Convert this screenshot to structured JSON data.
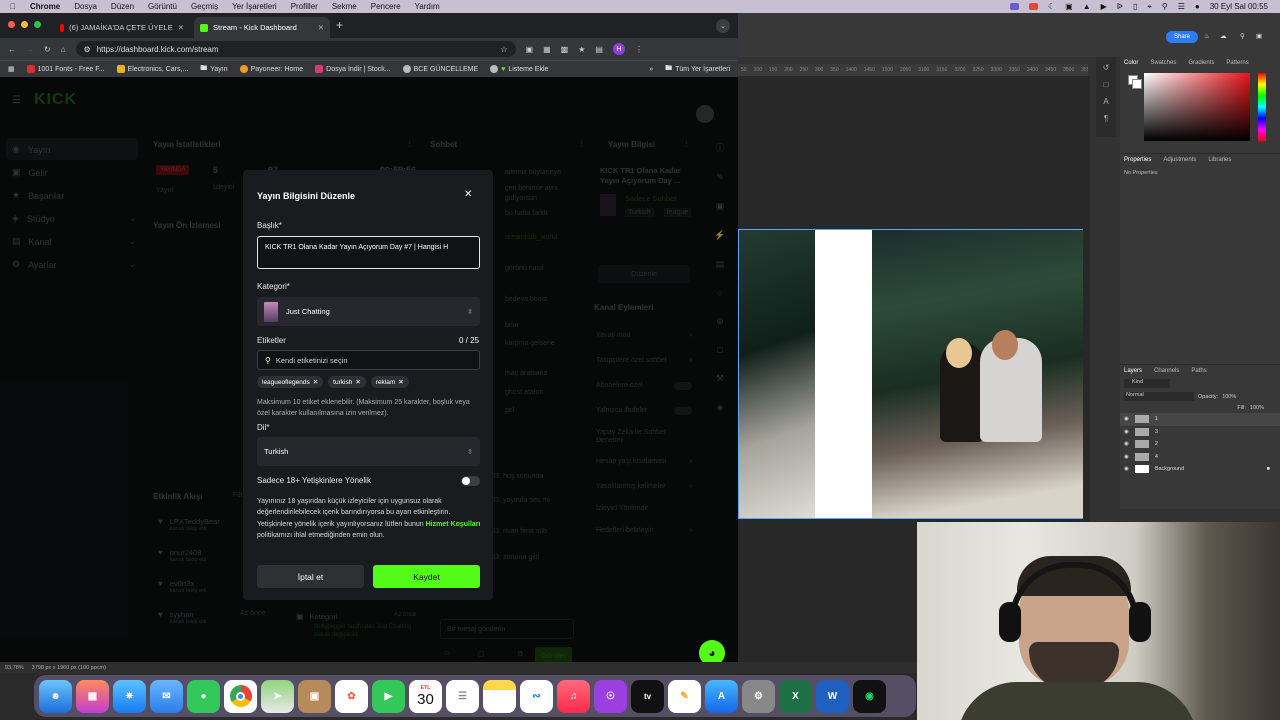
{
  "menubar": {
    "apple": "",
    "app": "Chrome",
    "items": [
      "Dosya",
      "Düzen",
      "Görüntü",
      "Geçmiş",
      "Yer İşaretleri",
      "Profiller",
      "Sekme",
      "Pencere",
      "Yardım"
    ],
    "datetime": "30 Eyl Sal 00:55"
  },
  "browser": {
    "tabs": [
      {
        "title": "(6) JAMAİKA'DA ÇETE ÜYELE",
        "active": false
      },
      {
        "title": "Stream - Kick Dashboard",
        "active": true
      }
    ],
    "url": "https://dashboard.kick.com/stream",
    "profile_letter": "H",
    "bookmarks": [
      "1001 Fonts - Free F...",
      "Electronics, Cars,...",
      "Yayın",
      "Payoneer: Home",
      "Dosya İndir | Stock...",
      "BCE GÜNCELLEME",
      "Listeme Ekle"
    ],
    "bookmarks_right": "Tüm Yer İşaretleri"
  },
  "kick": {
    "logo": "KICK",
    "sidebar": [
      "Yayın",
      "Gelir",
      "Başarılar",
      "Stüdyo",
      "Kanal",
      "Ayarlar"
    ],
    "stats_title": "Yayın İstatistikleri",
    "live_badge": "YAYINDA",
    "stats_label": "Yayın",
    "stats_value": "5",
    "stats_viewers": "İzleyici",
    "stats_time": "00:59:56",
    "stats_other": "97",
    "preview_title": "Yayın Ön İzlemesi",
    "chat_title": "Sohbet",
    "chat_lines": [
      "ailemiz büyümeye",
      "çen benimle aynı",
      "gidiyorsun",
      "bu hafta farklı",
      "dreamhub_world",
      "görünü nasıl",
      "bedeva boost",
      "brlar",
      "karpma gelsene",
      "maç aratsana",
      "ghost atalım",
      "gel",
      "jtq33: hoş sonunda",
      "jtq33: yayında ses mi",
      "jtq33: rivan fena süb",
      "jtq33: zoruma gitti"
    ],
    "chat_placeholder": "Bir mesaj gönderin",
    "send_label": "Gönder",
    "info_title": "Yayın Bilgisi",
    "info_stream_title": "KICK TR1 Olana Kadar Yayın Açıyorum Day ...",
    "info_category": "Sadece Sohbet",
    "info_tags": [
      "Turkish",
      "league"
    ],
    "edit_label": "Düzenle",
    "actions_title": "Kanal Eylemleri",
    "actions": [
      "Yavaş mod",
      "Takipçilere özel sohbet",
      "Abonelere özel",
      "Yalnızca ifadeler",
      "Yapay Zeka ile Sohbet Denetimi",
      "Hesap yaşı kısıtlaması",
      "Yasaklanmış kelimeler",
      "İzleyici Yönlendir",
      "Hedefleri belirleyin"
    ],
    "activity_title": "Etkinlik Akışı",
    "activity_filter": "Filt",
    "activity": [
      {
        "user": "LPXTeddyBear",
        "note": "kanalı takip etti"
      },
      {
        "user": "onur2408",
        "note": "kanalı takip etti"
      },
      {
        "user": "ev0rt3x",
        "note": "kanalı takip etti"
      },
      {
        "user": "syyhan",
        "note": "kanalı takip etti"
      }
    ],
    "activity_time": "Az önce",
    "category_card": {
      "title": "Kategori",
      "time": "Az önce",
      "text": "chillypepper tarafından Just Chatting olarak değiştirildi"
    }
  },
  "modal": {
    "title": "Yayın Bilgisini Düzenle",
    "title_label": "Başlık*",
    "title_value": "KICK TR1 Olana Kadar Yayın Açıyorum Day #7 | Hangisi H",
    "category_label": "Kategori*",
    "category_value": "Just Chatting",
    "tags_label": "Etiketler",
    "tags_count": "0 / 25",
    "tags_placeholder": "Kendi etiketinizi seçin",
    "tags": [
      "leagueoflegends",
      "turkish",
      "reklam"
    ],
    "tags_help": "Maksimum 10 etiket eklenebilir. (Maksimum 25 karakter, boşluk veya özel karakter kullanılmasına izin verilmez).",
    "lang_label": "Dil*",
    "lang_value": "Turkish",
    "adult_label": "Sadece 18+ Yetişkinlere Yönelik",
    "adult_on": false,
    "adult_help_1": "Yayınınız 18 yaşından küçük izleyiciler için uygunsuz olarak değerlendirilebilecek içerik barındırıyorsa bu ayarı etkinleştirin. Yetişkinlere yönelik içerik yayınlıyorsanız lütfen bunun",
    "adult_link": "Hizmet Koşulları",
    "adult_help_2": "politikamızı ihlal etmediğinden emin olun.",
    "cancel": "İptal et",
    "save": "Kaydet"
  },
  "photoshop": {
    "share": "Share",
    "ruler": [
      "50",
      "100",
      "150",
      "200",
      "250",
      "300",
      "350",
      "1400",
      "1450",
      "1500",
      "2050",
      "3100",
      "3150",
      "3200",
      "3250",
      "3300",
      "3350",
      "3400",
      "3450",
      "3500",
      "3550",
      "3600",
      "3650",
      "3700"
    ],
    "tabs_color": [
      "Color",
      "Swatches",
      "Gradients",
      "Patterns"
    ],
    "tabs_props": [
      "Properties",
      "Adjustments",
      "Libraries"
    ],
    "no_props": "No Properties",
    "tabs_layers": [
      "Layers",
      "Channels",
      "Paths"
    ],
    "kind": "Kind",
    "blend": "Normal",
    "opacity_label": "Opacity:",
    "opacity": "100%",
    "fill_label": "Fill:",
    "fill": "100%",
    "layers": [
      "1",
      "3",
      "2",
      "4",
      "Background"
    ],
    "status": "93,78%",
    "status_info": "3798 px x 1960 px (100 ppcm)"
  },
  "dock": {
    "calendar_month": "EYL",
    "calendar_day": "30"
  }
}
